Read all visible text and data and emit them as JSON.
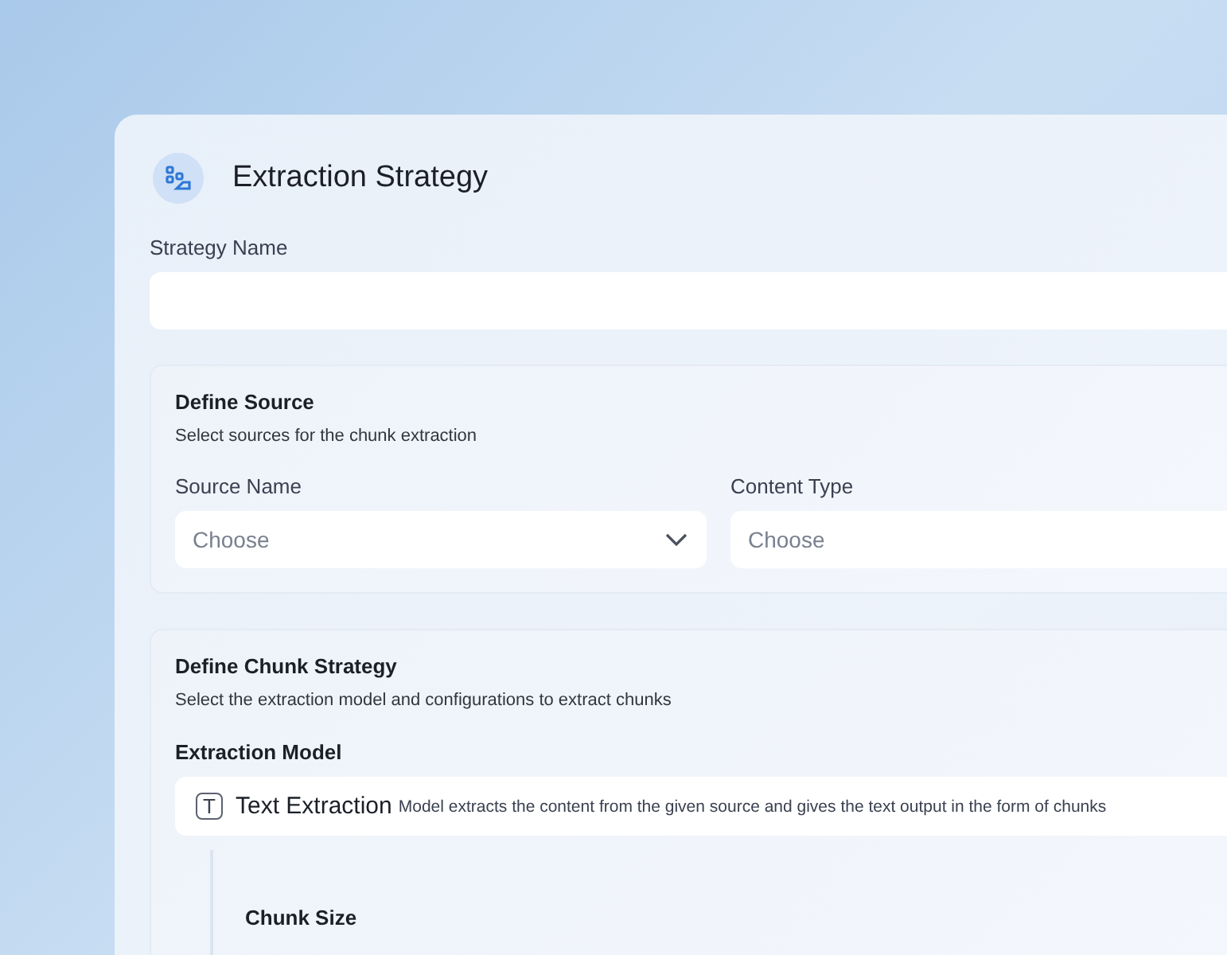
{
  "header": {
    "title": "Extraction Strategy"
  },
  "strategy_name": {
    "label": "Strategy Name"
  },
  "define_source": {
    "title": "Define Source",
    "subtitle": "Select sources for the chunk extraction",
    "fields": [
      {
        "label": "Source Name",
        "placeholder": "Choose",
        "kind": "dropdown"
      },
      {
        "label": "Content Type",
        "placeholder": "Choose",
        "kind": "text"
      }
    ]
  },
  "define_chunk_strategy": {
    "title": "Define Chunk Strategy",
    "subtitle": "Select the extraction model and configurations to extract chunks",
    "model_label": "Extraction Model",
    "model": {
      "icon_letter": "T",
      "name": "Text Extraction",
      "description": "Model extracts the content from the given source and gives the text output in the form of chunks"
    },
    "chunk_size_label": "Chunk Size"
  }
}
